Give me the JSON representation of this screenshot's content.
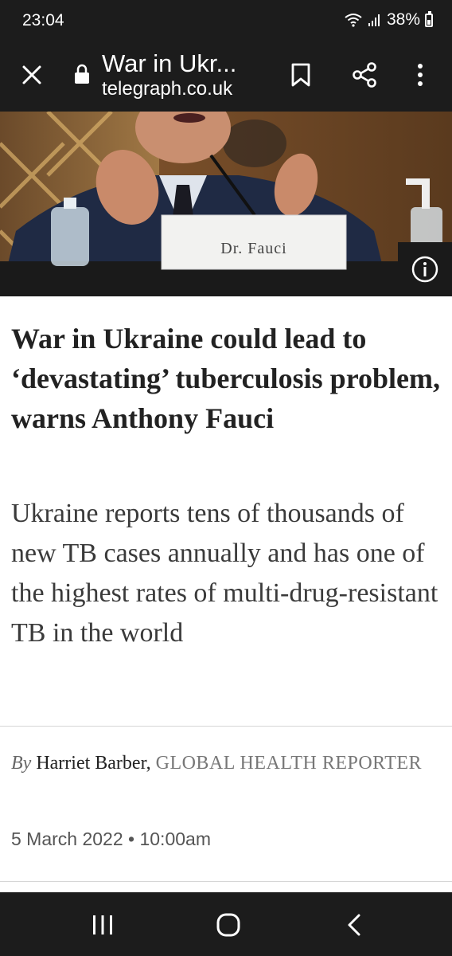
{
  "status_bar": {
    "time": "23:04",
    "battery": "38%"
  },
  "toolbar": {
    "title": "War in Ukr...",
    "domain": "telegraph.co.uk",
    "icons": [
      "close-icon",
      "lock-icon",
      "bookmark-icon",
      "share-icon",
      "more-vert-icon"
    ]
  },
  "hero": {
    "placard": "Dr. Fauci",
    "info_icon": "info-icon"
  },
  "article": {
    "headline": "War in Ukraine could lead to ‘devastating’ tuberculosis problem, warns Anthony Fauci",
    "standfirst": "Ukraine reports tens of thousands of new TB cases annually and has one of the highest rates of multi-drug-resistant TB in the world",
    "byline_prefix": "By",
    "author": "Harriet Barber,",
    "author_role": "GLOBAL HEALTH REPORTER",
    "date": "5 March 2022 • 10:00am"
  },
  "nav": {
    "icons": [
      "recents-icon",
      "home-icon",
      "back-icon"
    ]
  },
  "colors": {
    "chrome": "#1c1c1c",
    "headline": "#222222",
    "standfirst": "#3a3a3a"
  }
}
